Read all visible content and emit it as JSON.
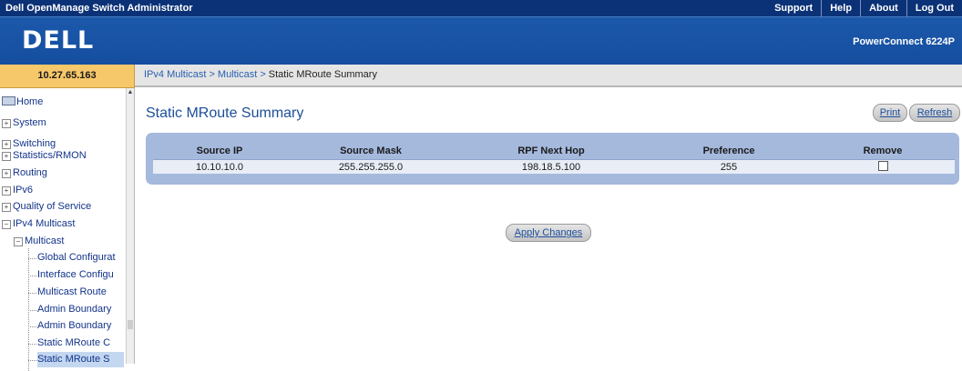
{
  "app_title": "Dell OpenManage Switch Administrator",
  "top_links": [
    "Support",
    "Help",
    "About",
    "Log Out"
  ],
  "brand": {
    "logo": "DELL",
    "model": "PowerConnect 6224P"
  },
  "address": "10.27.65.163",
  "breadcrumb": {
    "items": [
      "IPv4 Multicast",
      "Multicast"
    ],
    "separator": ">",
    "current": "Static MRoute Summary"
  },
  "tree": {
    "items": [
      "Home",
      "System",
      "Switching",
      "Statistics/RMON",
      "Routing",
      "IPv6",
      "Quality of Service",
      "IPv4 Multicast"
    ],
    "multicast": "Multicast",
    "leaves": [
      "Global Configurat",
      "Interface Configu",
      "Multicast Route ",
      "Admin Boundary",
      "Admin Boundary",
      "Static MRoute C",
      "Static MRoute S"
    ]
  },
  "page": {
    "title": "Static MRoute Summary",
    "print": "Print",
    "refresh": "Refresh",
    "apply": "Apply Changes"
  },
  "table": {
    "headers": [
      "Source IP",
      "Source Mask",
      "RPF Next Hop",
      "Preference",
      "Remove"
    ],
    "rows": [
      {
        "source_ip": "10.10.10.0",
        "source_mask": "255.255.255.0",
        "rpf_next_hop": "198.18.5.100",
        "preference": "255",
        "remove": false
      }
    ]
  },
  "colors": {
    "top_bar": "#0b3277",
    "brand_bar": "#1c58ab",
    "address_bg": "#f7c86a",
    "table_frame": "#a5b9dd",
    "title_text": "#1d4f9a"
  }
}
